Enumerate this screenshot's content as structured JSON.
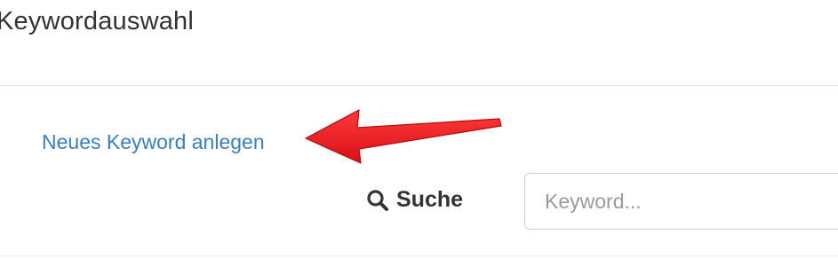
{
  "modal": {
    "title": "Keywordauswahl"
  },
  "actions": {
    "new_keyword_label": "Neues Keyword anlegen"
  },
  "search": {
    "label": "Suche",
    "icon": "search-icon",
    "placeholder": "Keyword...",
    "value": ""
  },
  "annotation": {
    "arrow_color": "#e8141b",
    "link_color": "#3a7fc1"
  }
}
